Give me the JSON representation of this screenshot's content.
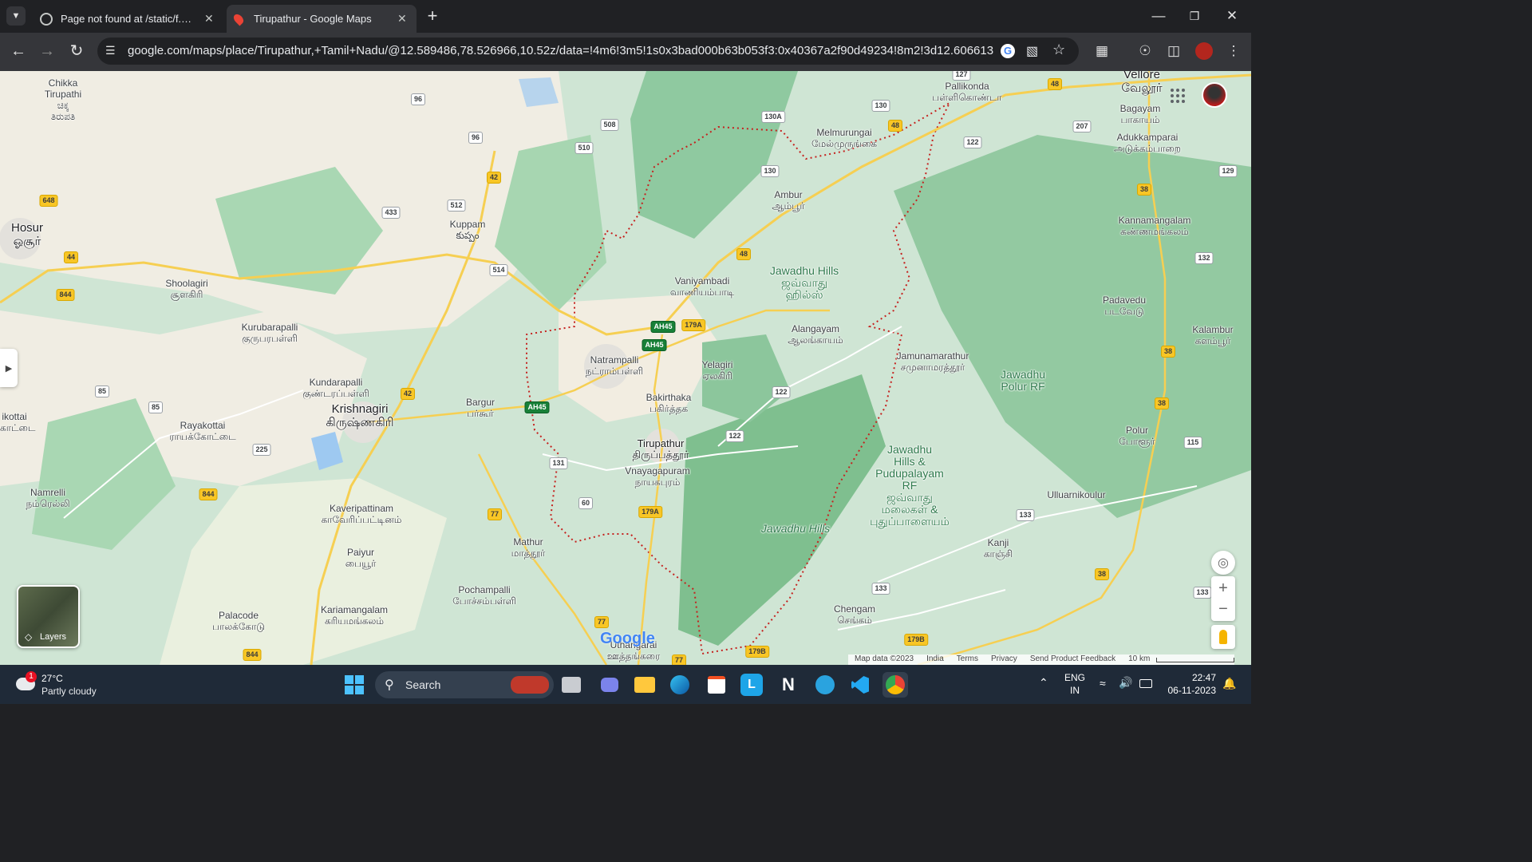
{
  "tabs": [
    {
      "title": "Page not found at /static/f.htm",
      "active": false
    },
    {
      "title": "Tirupathur - Google Maps",
      "active": true
    }
  ],
  "address": {
    "url": "google.com/maps/place/Tirupathur,+Tamil+Nadu/@12.589486,78.526966,10.52z/data=!4m6!3m5!1s0x3bad000b63b053f3:0x40367a2f90d49234!8m2!3d12.6066135!4d78...."
  },
  "map": {
    "places": [
      {
        "name": "Chikka\nTirupathi\nಚಿಕ್ಕ\nತಿರುಪತಿ"
      },
      {
        "name": "Hosur\nஓசூர்"
      },
      {
        "name": "Shoolagiri\nசூளகிரி"
      },
      {
        "name": "Kurubarapalli\nகுருபரபள்ளி"
      },
      {
        "name": "Kundarapalli\nகுண்டரப்பள்ளி"
      },
      {
        "name": "Krishnagiri\nகிருஷ்ணகிரி"
      },
      {
        "name": "Rayakottai\nராயக்கோட்டை"
      },
      {
        "name": "ikottai\nகோட்டை"
      },
      {
        "name": "Namrelli\nநம்ரெல்லி"
      },
      {
        "name": "Kaveripattinam\nகாவேரிப்பட்டினம்"
      },
      {
        "name": "Paiyur\nபையூர்"
      },
      {
        "name": "Kariamangalam\nகரியமங்கலம்"
      },
      {
        "name": "Palacode\nபாலக்கோடு"
      },
      {
        "name": "Kuppam\nకుప్పం"
      },
      {
        "name": "Bargur\nபர்கூர்"
      },
      {
        "name": "Pochampalli\nபோச்சம்பள்ளி"
      },
      {
        "name": "Mathur\nமாத்தூர்"
      },
      {
        "name": "Natrampalli\nநட்ராம்பள்ளி"
      },
      {
        "name": "Vaniyambadi\nவாணியம்பாடி"
      },
      {
        "name": "Bakirthaka\nபகிர்த்தக"
      },
      {
        "name": "Tirupathur\nதிருப்பத்தூர்"
      },
      {
        "name": "Vnayagapuram\nநாயகபுரம்"
      },
      {
        "name": "Yelagiri\nஏலகிரி"
      },
      {
        "name": "Alangayam\nஆலங்காயம்"
      },
      {
        "name": "Ambur\nஆம்பூர்"
      },
      {
        "name": "Melmurungai\nமேல்முருங்கை"
      },
      {
        "name": "Pallikonda\nபள்ளிகொண்டா"
      },
      {
        "name": "Vellore\nவேலூர்"
      },
      {
        "name": "Bagayam\nபாகாயம்"
      },
      {
        "name": "Adukkamparai\nஅடுக்கம்பாறை"
      },
      {
        "name": "Kannamangalam\nகண்ணமங்கலம்"
      },
      {
        "name": "Padavedu\nபடவேடு"
      },
      {
        "name": "Kalambur\nகளம்பூர்"
      },
      {
        "name": "Jamunamarathur\nசமுனாமரத்தூர்"
      },
      {
        "name": "Polur\nபோளூர்"
      },
      {
        "name": "Ulluarnikoulur"
      },
      {
        "name": "Kanji\nகாஞ்சி"
      },
      {
        "name": "Chengam\nசெங்கம்"
      },
      {
        "name": "Uthangarai\nஊத்தங்கரை"
      }
    ],
    "hills": [
      {
        "name": "Jawadhu Hills\nஜவ்வாது\nஹில்ஸ்"
      },
      {
        "name": "Jawadhu\nPolur RF"
      },
      {
        "name": "Jawadhu\nHills &\nPudupalayam\nRF\nஜவ்வாது\nமலைகள் &\nபுதுப்பாளையம்"
      },
      {
        "name": "Jawadhu Hills"
      }
    ],
    "shields": [
      {
        "label": "96",
        "kind": "w"
      },
      {
        "label": "96",
        "kind": "w"
      },
      {
        "label": "508",
        "kind": "w"
      },
      {
        "label": "510",
        "kind": "w"
      },
      {
        "label": "42",
        "kind": "y"
      },
      {
        "label": "512",
        "kind": "w"
      },
      {
        "label": "433",
        "kind": "w"
      },
      {
        "label": "648",
        "kind": "y"
      },
      {
        "label": "44",
        "kind": "y"
      },
      {
        "label": "844",
        "kind": "y"
      },
      {
        "label": "514",
        "kind": "w"
      },
      {
        "label": "130A",
        "kind": "w"
      },
      {
        "label": "130",
        "kind": "w"
      },
      {
        "label": "130",
        "kind": "w"
      },
      {
        "label": "48",
        "kind": "y"
      },
      {
        "label": "48",
        "kind": "y"
      },
      {
        "label": "48",
        "kind": "y"
      },
      {
        "label": "122",
        "kind": "w"
      },
      {
        "label": "207",
        "kind": "w"
      },
      {
        "label": "38",
        "kind": "y"
      },
      {
        "label": "129",
        "kind": "w"
      },
      {
        "label": "132",
        "kind": "w"
      },
      {
        "label": "AH45",
        "kind": "g"
      },
      {
        "label": "AH45",
        "kind": "g"
      },
      {
        "label": "AH45",
        "kind": "g"
      },
      {
        "label": "179A",
        "kind": "y"
      },
      {
        "label": "179A",
        "kind": "y"
      },
      {
        "label": "42",
        "kind": "y"
      },
      {
        "label": "85",
        "kind": "w"
      },
      {
        "label": "85",
        "kind": "w"
      },
      {
        "label": "225",
        "kind": "w"
      },
      {
        "label": "844",
        "kind": "y"
      },
      {
        "label": "844",
        "kind": "y"
      },
      {
        "label": "131",
        "kind": "w"
      },
      {
        "label": "60",
        "kind": "w"
      },
      {
        "label": "77",
        "kind": "y"
      },
      {
        "label": "77",
        "kind": "y"
      },
      {
        "label": "77",
        "kind": "y"
      },
      {
        "label": "122",
        "kind": "w"
      },
      {
        "label": "122",
        "kind": "w"
      },
      {
        "label": "38",
        "kind": "y"
      },
      {
        "label": "38",
        "kind": "y"
      },
      {
        "label": "115",
        "kind": "w"
      },
      {
        "label": "133",
        "kind": "w"
      },
      {
        "label": "133",
        "kind": "w"
      },
      {
        "label": "133",
        "kind": "w"
      },
      {
        "label": "38",
        "kind": "y"
      },
      {
        "label": "179B",
        "kind": "y"
      },
      {
        "label": "179B",
        "kind": "y"
      },
      {
        "label": "127",
        "kind": "w"
      }
    ],
    "layers_label": "Layers",
    "google_logo": "Google",
    "footer": {
      "map_data": "Map data ©2023",
      "country": "India",
      "terms": "Terms",
      "privacy": "Privacy",
      "feedback": "Send Product Feedback",
      "scale": "10 km"
    }
  },
  "taskbar": {
    "weather_temp": "27°C",
    "weather_desc": "Partly cloudy",
    "weather_badge": "1",
    "search_label": "Search",
    "lang": "ENG",
    "region": "IN",
    "time": "22:47",
    "date": "06-11-2023"
  }
}
